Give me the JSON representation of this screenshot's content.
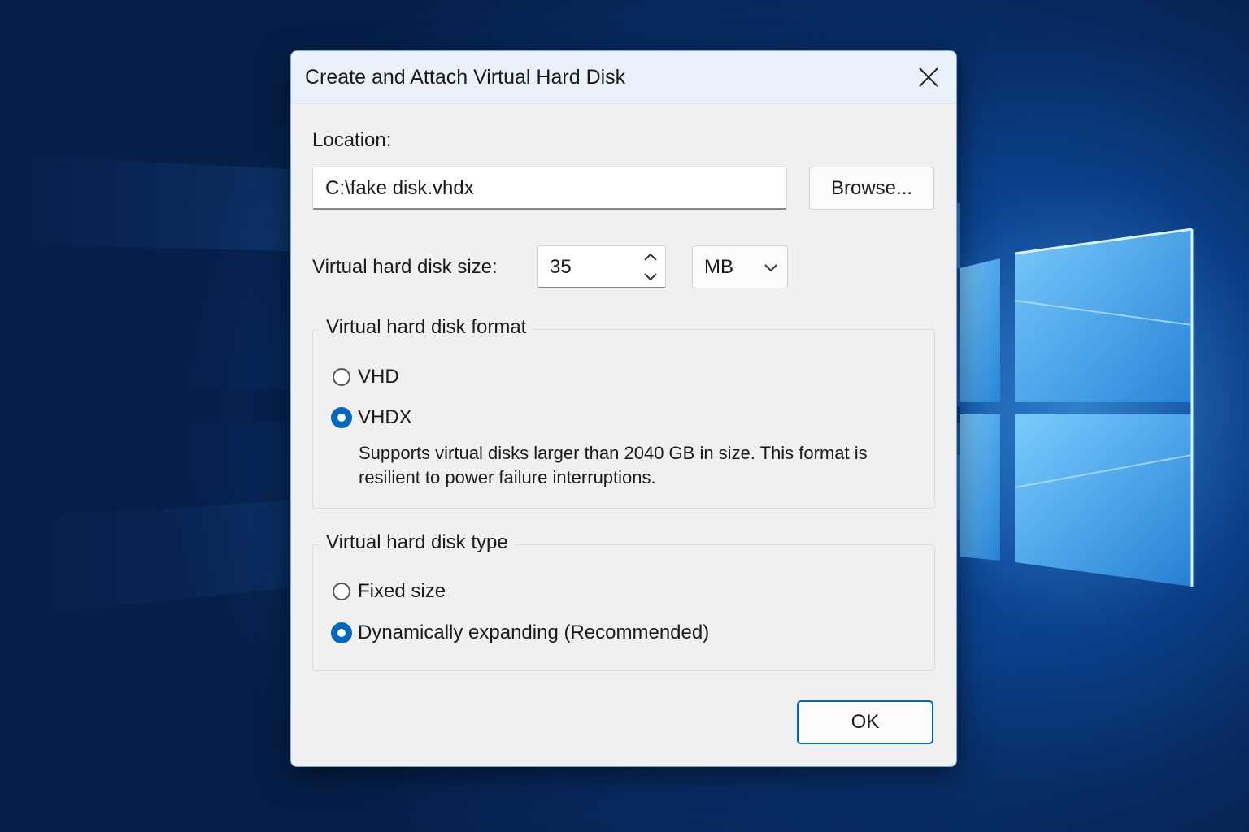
{
  "window": {
    "title": "Create and Attach Virtual Hard Disk"
  },
  "location": {
    "label": "Location:",
    "value": "C:\\fake disk.vhdx",
    "browse_label": "Browse..."
  },
  "size": {
    "label": "Virtual hard disk size:",
    "value": "35",
    "unit": "MB"
  },
  "format_group": {
    "title": "Virtual hard disk format",
    "options": [
      {
        "label": "VHD",
        "checked": false
      },
      {
        "label": "VHDX",
        "checked": true
      }
    ],
    "description": "Supports virtual disks larger than 2040 GB in size. This format is resilient to power failure interruptions."
  },
  "type_group": {
    "title": "Virtual hard disk type",
    "options": [
      {
        "label": "Fixed size",
        "checked": false
      },
      {
        "label": "Dynamically expanding (Recommended)",
        "checked": true
      }
    ]
  },
  "footer": {
    "ok_label": "OK"
  },
  "colors": {
    "accent": "#0067c0",
    "dialog_bg": "#f0f0f0",
    "titlebar_bg": "#eaf1fb"
  },
  "icons": {
    "close": "close-icon",
    "spin_up": "chevron-up-icon",
    "spin_down": "chevron-down-icon",
    "dropdown": "chevron-down-icon"
  }
}
